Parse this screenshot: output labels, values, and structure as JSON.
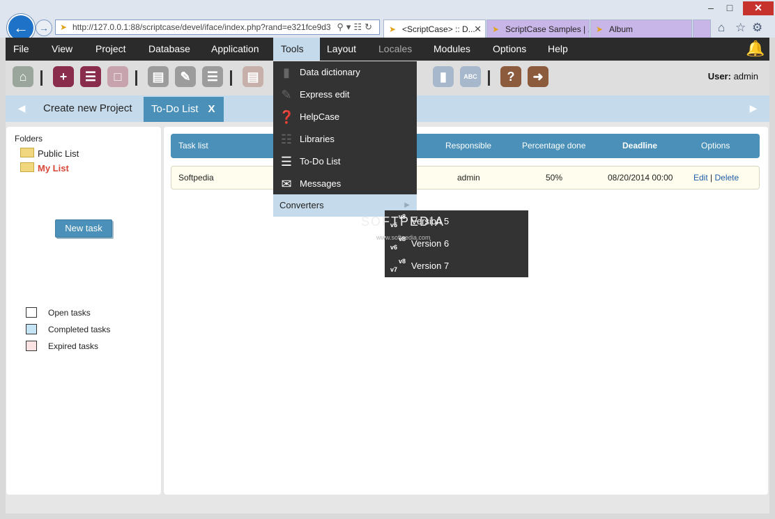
{
  "browser": {
    "url": "http://127.0.0.1:88/scriptcase/devel/iface/index.php?rand=e321fce9d3",
    "tabs": [
      {
        "title": "<ScriptCase> :: D..."
      },
      {
        "title": "ScriptCase Samples | ..."
      },
      {
        "title": "Album"
      }
    ],
    "window_controls": {
      "minimize": "–",
      "maximize": "□",
      "close": "✕"
    }
  },
  "menubar": {
    "items": [
      "File",
      "View",
      "Project",
      "Database",
      "Application",
      "Tools",
      "Layout",
      "Locales",
      "Modules",
      "Options",
      "Help"
    ],
    "active": "Tools"
  },
  "toolbar": {
    "user_label": "User:",
    "user_name": "admin"
  },
  "project_tabs": [
    {
      "label": "Create new Project"
    },
    {
      "label": "To-Do List",
      "close": "X"
    }
  ],
  "sidebar": {
    "folders_title": "Folders",
    "folders": [
      "Public List",
      "My List"
    ],
    "new_task_label": "New task",
    "legend": [
      {
        "label": "Open tasks",
        "color": "#ffffff"
      },
      {
        "label": "Completed tasks",
        "color": "#c5e5f7"
      },
      {
        "label": "Expired tasks",
        "color": "#fbe3e3"
      }
    ]
  },
  "grid": {
    "columns": [
      "Task list",
      "Responsible",
      "Percentage done",
      "Deadline",
      "Options"
    ],
    "rows": [
      {
        "task": "Softpedia",
        "responsible": "admin",
        "percent": "50%",
        "deadline": "08/20/2014 00:00",
        "edit": "Edit",
        "sep": "|",
        "delete": "Delete"
      }
    ]
  },
  "tools_menu": {
    "items": [
      "Data dictionary",
      "Express edit",
      "HelpCase",
      "Libraries",
      "To-Do List",
      "Messages",
      "Converters"
    ]
  },
  "converters_menu": {
    "items": [
      {
        "label": "Version 5",
        "from": "v5",
        "to": "v8"
      },
      {
        "label": "Version 6",
        "from": "v6",
        "to": "v8"
      },
      {
        "label": "Version 7",
        "from": "v7",
        "to": "v8"
      }
    ]
  },
  "watermark": {
    "text": "SOFTPEDIA",
    "sub": "www.softpedia.com"
  },
  "colors": {
    "accent": "#4a90b8",
    "menubar": "#2b2b2b",
    "highlight": "#c5dbec",
    "expired_label": "#d9463a"
  }
}
